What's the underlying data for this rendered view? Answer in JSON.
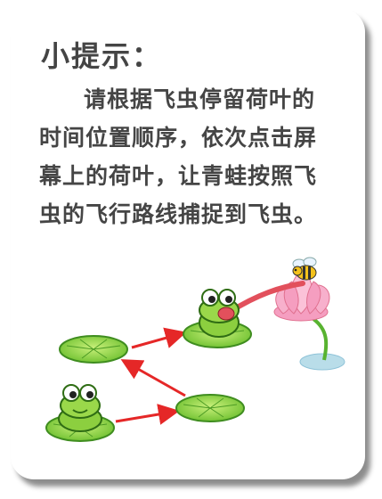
{
  "hint": {
    "title": "小提示：",
    "body": "请根据飞虫停留荷叶的时间位置顺序，依次点击屏幕上的荷叶，让青蛙按照飞虫的飞行路线捕捉到飞虫。"
  },
  "colors": {
    "leaf": "#8dd44a",
    "leaf_dark": "#3f8d1f",
    "frog": "#8ccf3f",
    "arrow": "#e52727",
    "tongue": "#e2505c",
    "lotus": "#f59ec0",
    "water": "#b9dde9"
  }
}
